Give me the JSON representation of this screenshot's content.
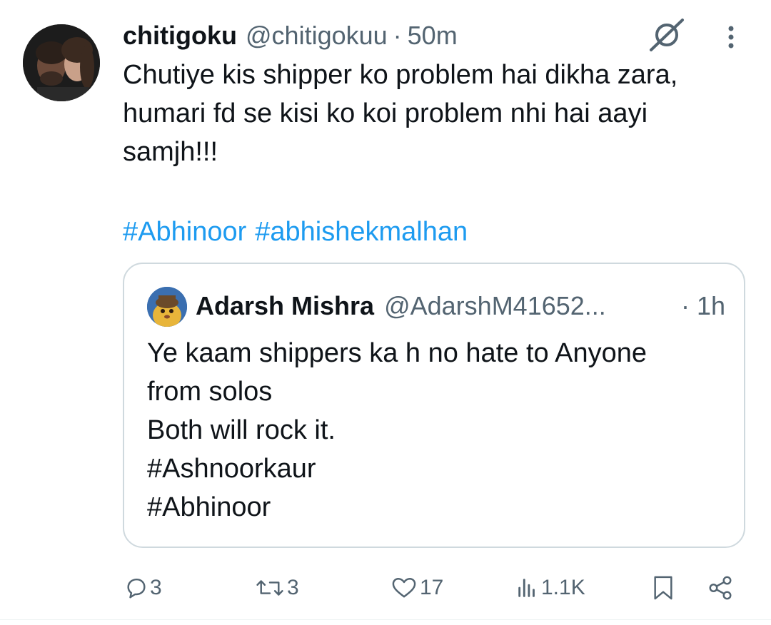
{
  "tweet": {
    "display_name": "chitigoku",
    "handle": "@chitigokuu",
    "separator": "·",
    "time": "50m",
    "text_lines": [
      "Chutiye kis shipper ko problem hai dikha zara,",
      "humari fd se kisi ko koi problem nhi hai aayi",
      "samjh!!!"
    ],
    "hashtags": [
      "#Abhinoor",
      "#abhishekmalhan"
    ],
    "link_color": "#1d9bf0"
  },
  "quote": {
    "display_name": "Adarsh Mishra",
    "handle": "@AdarshM41652...",
    "time": "· 1h",
    "text_lines": [
      "Ye kaam shippers ka h no hate to Anyone",
      "from solos",
      "Both will rock it.",
      "#Ashnoorkaur",
      "#Abhinoor"
    ]
  },
  "actions": {
    "replies": "3",
    "reposts": "3",
    "likes": "17",
    "views": "1.1K"
  },
  "icons": {
    "grok": "grok-icon",
    "more": "more-vertical-icon",
    "reply": "reply-icon",
    "repost": "repost-icon",
    "like": "heart-icon",
    "views": "views-icon",
    "bookmark": "bookmark-icon",
    "share": "share-icon"
  },
  "colors": {
    "text": "#0f1419",
    "secondary": "#536471",
    "border": "#cfd9de",
    "accent": "#1d9bf0"
  }
}
